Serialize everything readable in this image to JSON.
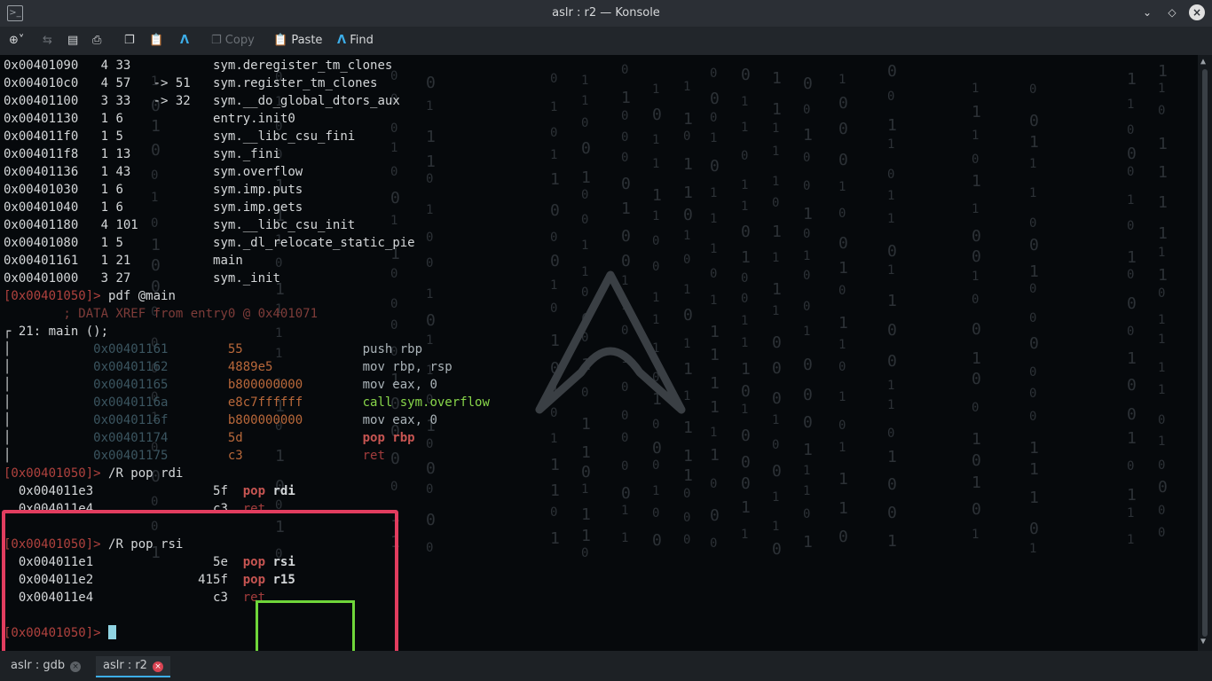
{
  "window": {
    "title": "aslr : r2 — Konsole"
  },
  "toolbar": {
    "copy_label": "Copy",
    "paste_label": "Paste",
    "find_label": "Find"
  },
  "terminal": {
    "function_list": [
      {
        "addr": "0x00401090",
        "nbbs": "4",
        "size": "33",
        "calls": "",
        "name": "sym.deregister_tm_clones"
      },
      {
        "addr": "0x004010c0",
        "nbbs": "4",
        "size": "57",
        "calls": "-> 51",
        "name": "sym.register_tm_clones"
      },
      {
        "addr": "0x00401100",
        "nbbs": "3",
        "size": "33",
        "calls": "-> 32",
        "name": "sym.__do_global_dtors_aux"
      },
      {
        "addr": "0x00401130",
        "nbbs": "1",
        "size": "6",
        "calls": "",
        "name": "entry.init0"
      },
      {
        "addr": "0x004011f0",
        "nbbs": "1",
        "size": "5",
        "calls": "",
        "name": "sym.__libc_csu_fini"
      },
      {
        "addr": "0x004011f8",
        "nbbs": "1",
        "size": "13",
        "calls": "",
        "name": "sym._fini"
      },
      {
        "addr": "0x00401136",
        "nbbs": "1",
        "size": "43",
        "calls": "",
        "name": "sym.overflow"
      },
      {
        "addr": "0x00401030",
        "nbbs": "1",
        "size": "6",
        "calls": "",
        "name": "sym.imp.puts"
      },
      {
        "addr": "0x00401040",
        "nbbs": "1",
        "size": "6",
        "calls": "",
        "name": "sym.imp.gets"
      },
      {
        "addr": "0x00401180",
        "nbbs": "4",
        "size": "101",
        "calls": "",
        "name": "sym.__libc_csu_init"
      },
      {
        "addr": "0x00401080",
        "nbbs": "1",
        "size": "5",
        "calls": "",
        "name": "sym._dl_relocate_static_pie"
      },
      {
        "addr": "0x00401161",
        "nbbs": "1",
        "size": "21",
        "calls": "",
        "name": "main"
      },
      {
        "addr": "0x00401000",
        "nbbs": "3",
        "size": "27",
        "calls": "",
        "name": "sym._init"
      }
    ],
    "prompt": "[0x00401050]>",
    "pdf_cmd": "pdf @main",
    "xref": "; DATA XREF from entry0 @ 0x401071",
    "func_header": "21: main ();",
    "disasm": [
      {
        "addr": "0x00401161",
        "bytes": "55",
        "ins": "push rbp"
      },
      {
        "addr": "0x00401162",
        "bytes": "4889e5",
        "ins": "mov rbp, rsp"
      },
      {
        "addr": "0x00401165",
        "bytes": "b800000000",
        "ins": "mov eax, 0"
      },
      {
        "addr": "0x0040116a",
        "bytes": "e8c7ffffff",
        "ins": "call sym.overflow"
      },
      {
        "addr": "0x0040116f",
        "bytes": "b800000000",
        "ins": "mov eax, 0"
      },
      {
        "addr": "0x00401174",
        "bytes": "5d",
        "ins": "pop rbp"
      },
      {
        "addr": "0x00401175",
        "bytes": "c3",
        "ins": "ret"
      }
    ],
    "rop_cmd1": "/R pop rdi",
    "rop1": [
      {
        "addr": "0x004011e3",
        "bytes": "5f",
        "op": "pop",
        "arg": "rdi"
      },
      {
        "addr": "0x004011e4",
        "bytes": "c3",
        "op": "ret",
        "arg": ""
      }
    ],
    "rop_cmd2": "/R pop rsi",
    "rop2": [
      {
        "addr": "0x004011e1",
        "bytes": "5e",
        "op": "pop",
        "arg": "rsi"
      },
      {
        "addr": "0x004011e2",
        "bytes": "415f",
        "op": "pop",
        "arg": "r15"
      },
      {
        "addr": "0x004011e4",
        "bytes": "c3",
        "op": "ret",
        "arg": ""
      }
    ]
  },
  "tabs": [
    {
      "label": "aslr : gdb",
      "active": false
    },
    {
      "label": "aslr : r2",
      "active": true
    }
  ],
  "colors": {
    "highlight_red": "#e23d5f",
    "highlight_green": "#6fd63a",
    "cursor": "#8fd3e2"
  }
}
